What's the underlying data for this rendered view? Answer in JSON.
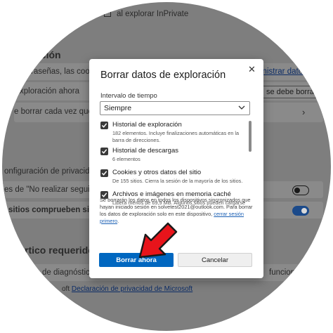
{
  "background": {
    "inprivate_text": "al explorar InPrivate",
    "section_heading": "ación",
    "row1_text": "ontraseñas, las cooki",
    "row1_link": "inistrar datos",
    "row2_text": "xploración ahora",
    "row2_button": "se debe borrar",
    "row3_text": "e borrar cada vez que se ci",
    "privacy_config_text": "onfiguración de privacidad de Mi",
    "dnt_text": "es de \"No realizar seguimient",
    "sites_text": "sitios comprueben si tiene n",
    "heading2": "rtico requeridos",
    "diag_text": "de diagnóstico r",
    "diag_right": "funcionar",
    "ms_link": "Declaración de privacidad de Microsoft",
    "ms_prefix": "oft",
    "toggle_dnt": false,
    "toggle_sites": true
  },
  "dialog": {
    "title": "Borrar datos de exploración",
    "time_label": "Intervalo de tiempo",
    "time_value": "Siempre",
    "items": [
      {
        "title": "Historial de exploración",
        "desc": "182 elementos. Incluye finalizaciones automáticas en la barra de direcciones.",
        "checked": true
      },
      {
        "title": "Historial de descargas",
        "desc": "6 elementos",
        "checked": true
      },
      {
        "title": "Cookies y otros datos del sitio",
        "desc": "De 155 sitios. Cierra la sesión de la mayoría de los sitios.",
        "checked": true
      },
      {
        "title": "Archivos e imágenes en memoria caché",
        "desc": "Libera menos de 69,9 MB. Algunos sitios pueden cargarse",
        "checked": true
      }
    ],
    "note": "Se borrarán los datos en todos los dispositivos sincronizados que hayan iniciado sesión en solvetest2021@outlook.com. Para borrar los datos de exploración solo en este dispositivo,",
    "note_link": "cerrar sesión primero",
    "note_end": ".",
    "clear_button": "Borrar ahora",
    "cancel_button": "Cancelar"
  },
  "colors": {
    "primary": "#0067c0",
    "arrow": "#e8141b"
  }
}
